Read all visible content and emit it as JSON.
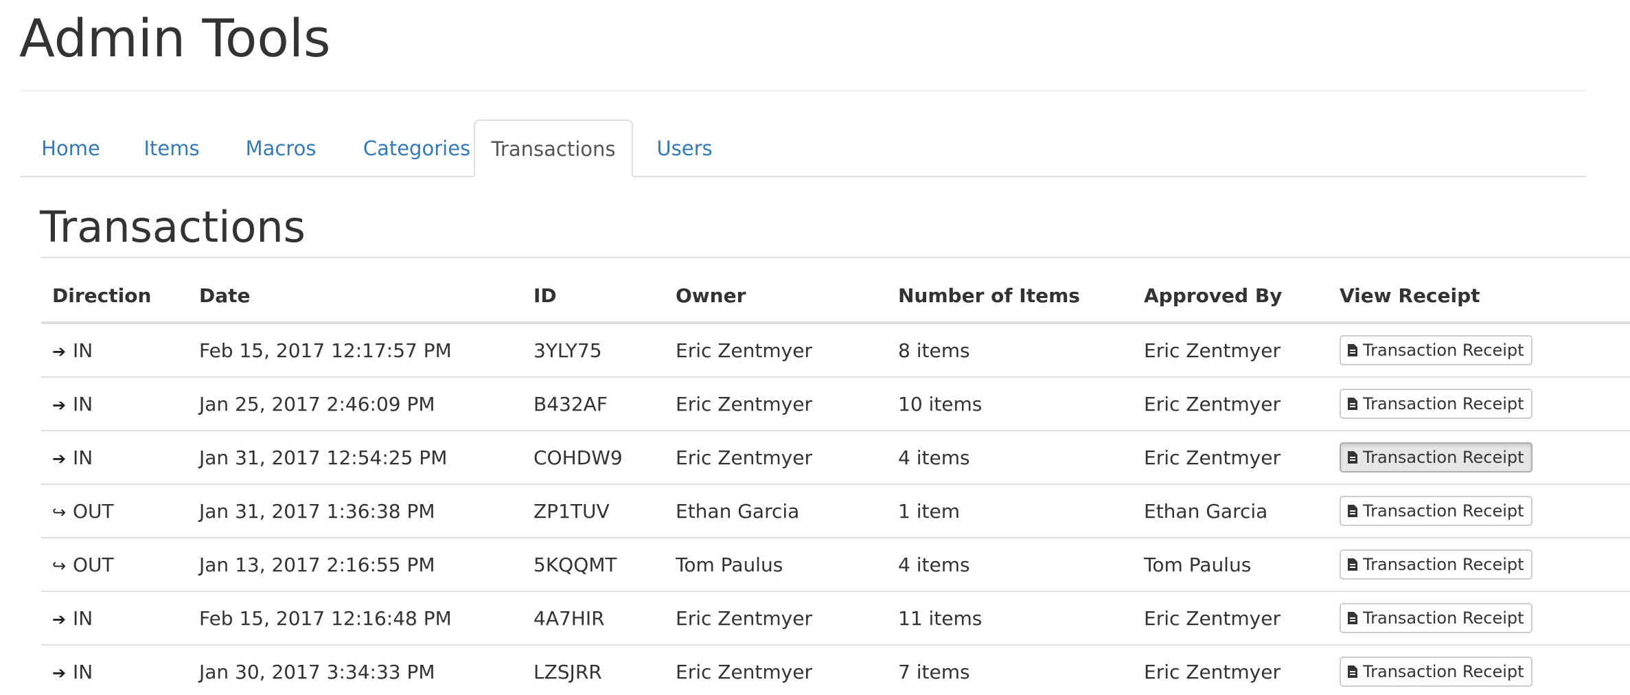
{
  "page": {
    "title": "Admin Tools"
  },
  "nav": {
    "tabs": [
      {
        "label": "Home",
        "active": false
      },
      {
        "label": "Items",
        "active": false
      },
      {
        "label": "Macros",
        "active": false
      },
      {
        "label": "Categories",
        "active": false
      },
      {
        "label": "Transactions",
        "active": true
      },
      {
        "label": "Users",
        "active": false
      }
    ]
  },
  "section": {
    "title": "Transactions"
  },
  "table": {
    "columns": [
      "Direction",
      "Date",
      "ID",
      "Owner",
      "Number of Items",
      "Approved By",
      "View Receipt"
    ],
    "rows": [
      {
        "direction": "IN",
        "direction_icon": "sign-in-icon",
        "date": "Feb 15, 2017 12:17:57 PM",
        "id": "3YLY75",
        "owner": "Eric Zentmyer",
        "items": "8 items",
        "approved_by": "Eric Zentmyer",
        "receipt_label": "Transaction Receipt"
      },
      {
        "direction": "IN",
        "direction_icon": "sign-in-icon",
        "date": "Jan 25, 2017 2:46:09 PM",
        "id": "B432AF",
        "owner": "Eric Zentmyer",
        "items": "10 items",
        "approved_by": "Eric Zentmyer",
        "receipt_label": "Transaction Receipt"
      },
      {
        "direction": "IN",
        "direction_icon": "sign-in-icon",
        "date": "Jan 31, 2017 12:54:25 PM",
        "id": "COHDW9",
        "owner": "Eric Zentmyer",
        "items": "4 items",
        "approved_by": "Eric Zentmyer",
        "receipt_label": "Transaction Receipt"
      },
      {
        "direction": "OUT",
        "direction_icon": "sign-out-icon",
        "date": "Jan 31, 2017 1:36:38 PM",
        "id": "ZP1TUV",
        "owner": "Ethan Garcia",
        "items": "1 item",
        "approved_by": "Ethan Garcia",
        "receipt_label": "Transaction Receipt"
      },
      {
        "direction": "OUT",
        "direction_icon": "sign-out-icon",
        "date": "Jan 13, 2017 2:16:55 PM",
        "id": "5KQQMT",
        "owner": "Tom Paulus",
        "items": "4 items",
        "approved_by": "Tom Paulus",
        "receipt_label": "Transaction Receipt"
      },
      {
        "direction": "IN",
        "direction_icon": "sign-in-icon",
        "date": "Feb 15, 2017 12:16:48 PM",
        "id": "4A7HIR",
        "owner": "Eric Zentmyer",
        "items": "11 items",
        "approved_by": "Eric Zentmyer",
        "receipt_label": "Transaction Receipt"
      },
      {
        "direction": "IN",
        "direction_icon": "sign-in-icon",
        "date": "Jan 30, 2017 3:34:33 PM",
        "id": "LZSJRR",
        "owner": "Eric Zentmyer",
        "items": "7 items",
        "approved_by": "Eric Zentmyer",
        "receipt_label": "Transaction Receipt"
      }
    ]
  },
  "colors": {
    "link": "#337ab7",
    "text": "#333333",
    "border": "#dddddd"
  }
}
